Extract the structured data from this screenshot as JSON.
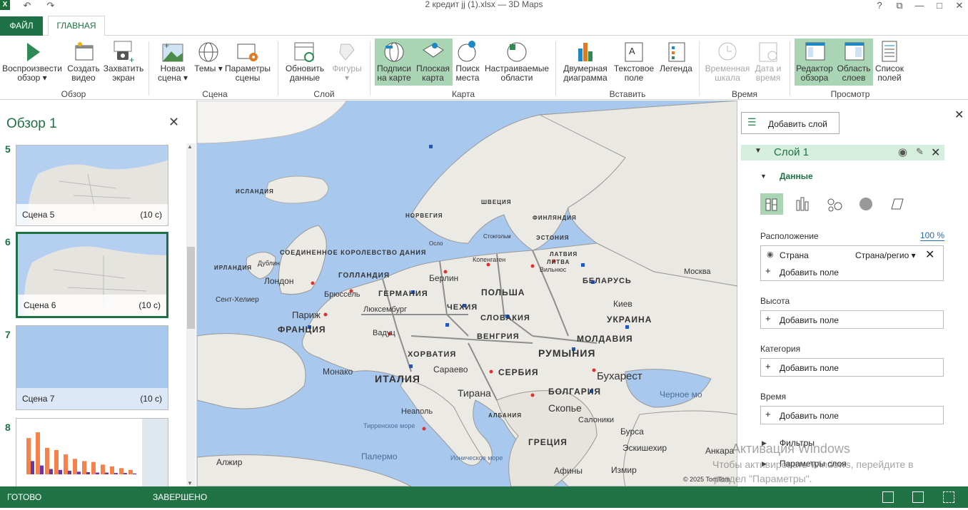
{
  "window": {
    "title": "2 кредит jj (1).xlsx — 3D Maps",
    "help": "?",
    "restore": "⧉",
    "min": "—",
    "max": "□",
    "close": "✕"
  },
  "tabs": {
    "file": "ФАЙЛ",
    "home": "ГЛАВНАЯ"
  },
  "ribbon": {
    "play": "Воспроизвести обзор ▾",
    "create_video": "Создать видео",
    "capture": "Захватить экран",
    "new_scene": "Новая сцена ▾",
    "themes": "Темы ▾",
    "scene_options": "Параметры сцены",
    "refresh": "Обновить данные",
    "shapes": "Фигуры ▾",
    "map_labels": "Подписи на карте",
    "flat_map": "Плоская карта",
    "find_location": "Поиск места",
    "custom_regions": "Настраиваемые области",
    "2d_chart": "Двумерная диаграмма",
    "text_box": "Текстовое поле",
    "legend": "Легенда",
    "timeline": "Временная шкала",
    "date_time": "Дата и время",
    "tour_editor": "Редактор обзора",
    "layer_pane": "Область слоев",
    "field_list": "Список полей",
    "groups": {
      "tour": "Обзор",
      "scene": "Сцена",
      "layer": "Слой",
      "map": "Карта",
      "insert": "Вставить",
      "time": "Время",
      "view": "Просмотр"
    }
  },
  "tour_panel": {
    "title": "Обзор 1",
    "close": "✕",
    "scenes": [
      {
        "num": "5",
        "name": "Сцена 5",
        "dur": "(10 с)"
      },
      {
        "num": "6",
        "name": "Сцена 6",
        "dur": "(10 с)"
      },
      {
        "num": "7",
        "name": "Сцена 7",
        "dur": "(10 с)"
      },
      {
        "num": "8",
        "name": "",
        "dur": ""
      }
    ]
  },
  "map_labels": {
    "copyright": "© 2025 TomTom",
    "places": [
      "ИСЛАНДИЯ",
      "НОРВЕГИЯ",
      "ШВЕЦИЯ",
      "ФИНЛЯНДИЯ",
      "ЭСТОНИЯ",
      "ЛАТВИЯ",
      "ЛИТВА",
      "Стокгольм",
      "Осло",
      "Копенгаген",
      "ДАНИЯ",
      "СОЕДИНЕННОЕ КОРОЛЕВСТВО",
      "ИРЛАНДИЯ",
      "Дублин",
      "Лондон",
      "ГОЛЛАНДИЯ",
      "Берлин",
      "ПОЛЬША",
      "БЕЛАРУСЬ",
      "Вильнюс",
      "Москва",
      "Брюссель",
      "ГЕРМАНИЯ",
      "Сент-Хелиер",
      "Люксембург",
      "Париж",
      "ЧЕХИЯ",
      "СЛОВАКИЯ",
      "Киев",
      "УКРАИНА",
      "ФРАНЦИЯ",
      "Вадуц",
      "ВЕНГРИЯ",
      "МОЛДАВИЯ",
      "ХОРВАТИЯ",
      "РУМЫНИЯ",
      "Монако",
      "Сараево",
      "СЕРБИЯ",
      "Бухарест",
      "ИТАЛИЯ",
      "Тирана",
      "БОЛГАРИЯ",
      "Черное мо",
      "Неаполь",
      "Скопье",
      "АЛБАНИЯ",
      "Тирренское море",
      "Салоники",
      "Бурса",
      "ГРЕЦИЯ",
      "Эскишехир",
      "Анкара",
      "Палермо",
      "Ионическое море",
      "Алжир",
      "Афины",
      "Измир"
    ]
  },
  "layer_panel": {
    "add_layer": "Добавить слой",
    "layer_name": "Слой 1",
    "data_heading": "Данные",
    "location_label": "Расположение",
    "location_pct": "100 %",
    "location_field": "Страна",
    "location_type": "Страна/регио ▾",
    "add_field": "Добавить поле",
    "height_label": "Высота",
    "category_label": "Категория",
    "time_label": "Время",
    "filters": "Фильтры",
    "layer_options": "Параметры слоя",
    "close": "✕"
  },
  "status": {
    "ready": "ГОТОВО",
    "done": "ЗАВЕРШЕНО"
  },
  "watermark": {
    "line1": "Активация Windows",
    "line2": "Чтобы активировать Windows, перейдите в",
    "line3": "раздел \"Параметры\"."
  },
  "colors": {
    "accent": "#1e7145",
    "status_bar": "#217346",
    "selected": "#a9d5b4",
    "sea": "#a8c8ee",
    "land": "#eceae4"
  },
  "chart_thumb": {
    "bars": [
      0.82,
      0.95,
      0.6,
      0.55,
      0.45,
      0.35,
      0.3,
      0.28,
      0.22,
      0.18,
      0.14,
      0.1
    ],
    "bars2": [
      0.3,
      0.2,
      0.12,
      0.1,
      0.08,
      0.06,
      0.05,
      0.04,
      0.04,
      0.03,
      0.03,
      0.02
    ]
  }
}
